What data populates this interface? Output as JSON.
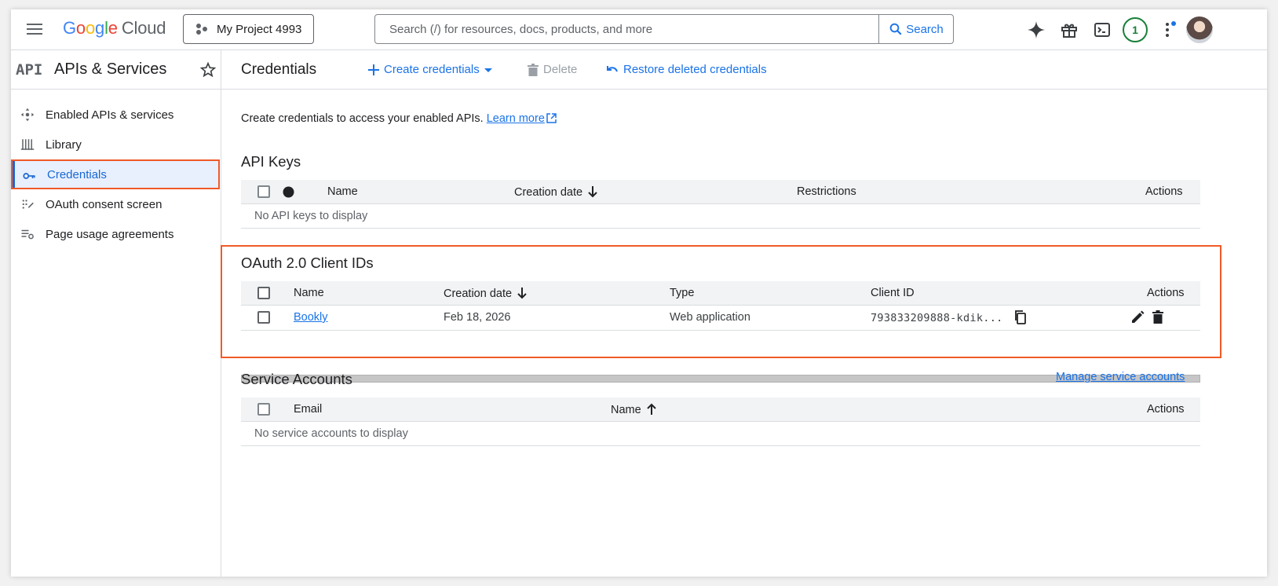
{
  "topbar": {
    "logo_google": [
      "G",
      "o",
      "o",
      "g",
      "l",
      "e"
    ],
    "logo_cloud": "Cloud",
    "project": "My Project 4993",
    "search_placeholder": "Search (/) for resources, docs, products, and more",
    "search_button": "Search",
    "notification_count": "1"
  },
  "sidebar": {
    "logo": "API",
    "title": "APIs & Services",
    "items": [
      {
        "label": "Enabled APIs & services",
        "icon": "hub-icon"
      },
      {
        "label": "Library",
        "icon": "library-icon"
      },
      {
        "label": "Credentials",
        "icon": "key-icon",
        "active": true
      },
      {
        "label": "OAuth consent screen",
        "icon": "consent-icon"
      },
      {
        "label": "Page usage agreements",
        "icon": "settings-list-icon"
      }
    ]
  },
  "main": {
    "title": "Credentials",
    "actions": {
      "create": "Create credentials",
      "delete": "Delete",
      "restore": "Restore deleted credentials"
    },
    "intro": "Create credentials to access your enabled APIs.",
    "learn_more": "Learn more",
    "api_keys": {
      "title": "API Keys",
      "columns": {
        "name": "Name",
        "creation_date": "Creation date",
        "restrictions": "Restrictions",
        "actions": "Actions"
      },
      "empty": "No API keys to display"
    },
    "oauth": {
      "title": "OAuth 2.0 Client IDs",
      "columns": {
        "name": "Name",
        "creation_date": "Creation date",
        "type": "Type",
        "client_id": "Client ID",
        "actions": "Actions"
      },
      "rows": [
        {
          "name": "Bookly",
          "creation_date": "Feb 18, 2026",
          "type": "Web application",
          "client_id": "793833209888-kdik..."
        }
      ]
    },
    "service_accounts": {
      "title": "Service Accounts",
      "manage": "Manage service accounts",
      "columns": {
        "email": "Email",
        "name": "Name",
        "actions": "Actions"
      },
      "empty": "No service accounts to display"
    }
  },
  "colors": {
    "accent": "#1a73e8",
    "highlight": "#f05a28",
    "active_bg": "#e8f0fe"
  }
}
